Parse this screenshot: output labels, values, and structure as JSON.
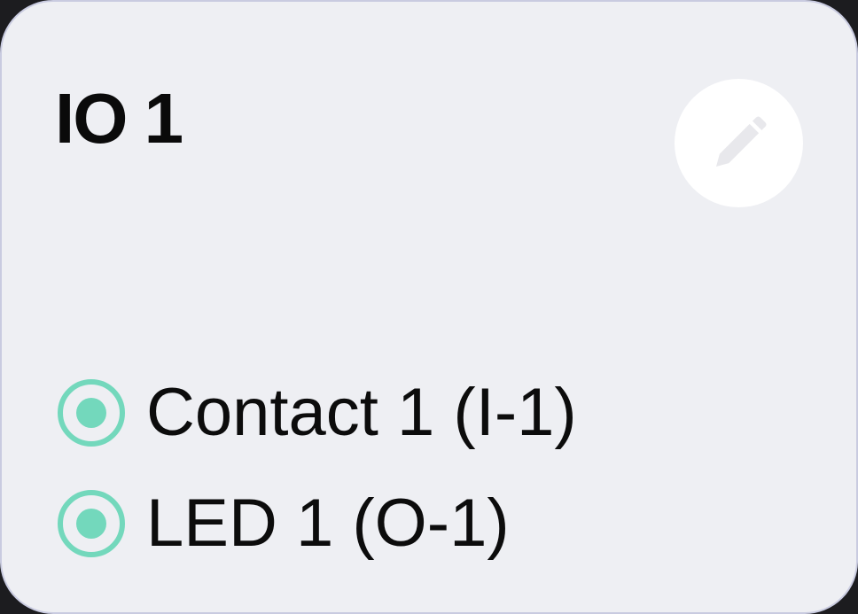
{
  "card": {
    "title": "IO 1",
    "edit_icon": "pencil-icon",
    "accent_color": "#73d8bc",
    "items": [
      {
        "label": "Contact 1 (I-1)",
        "icon": "radio-selected-icon",
        "selected": true
      },
      {
        "label": "LED 1 (O-1)",
        "icon": "radio-selected-icon",
        "selected": true
      }
    ]
  }
}
